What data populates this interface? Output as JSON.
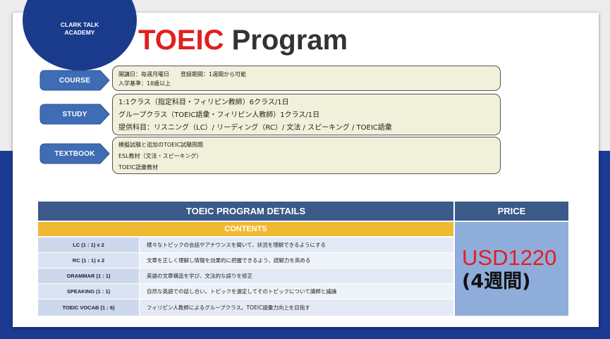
{
  "logo": {
    "line1": "CLARK TALK",
    "line2": "ACADEMY"
  },
  "title": {
    "highlight": "TOEIC",
    "rest": " Program"
  },
  "sections": [
    {
      "tag": "COURSE",
      "lines": [
        "開講日：毎週月曜日　　登録期間：1週間から可能",
        "入学基準：18歳以上"
      ]
    },
    {
      "tag": "STUDY",
      "lines": [
        "1:1クラス（指定科目・フィリピン教師）6クラス/1日",
        "グループクラス（TOEIC語彙・フィリピン人教師）1クラス/1日",
        "提供科目：リスニング（LC）/ リーディング（RC）/ 文法 / スピーキング / TOEIC語彙"
      ]
    },
    {
      "tag": "TEXTBOOK",
      "lines": [
        "模擬試験と追加のTOEIC試験問題",
        "ESL教材（文法・スピーキング）",
        "TOEIC語彙教材"
      ]
    }
  ],
  "table": {
    "header_details": "TOEIC PROGRAM DETAILS",
    "header_price": "PRICE",
    "contents_label": "CONTENTS",
    "rows": [
      {
        "label": "LC (1 : 1) x 2",
        "desc": "様々なトピックの会話やアナウンスを聞いて、状況を理解できるようにする"
      },
      {
        "label": "RC (1 : 1) x 2",
        "desc": "文章を正しく理解し情報を効果的に把握できるよう、読解力を高める"
      },
      {
        "label": "GRAMMAR (1 : 1)",
        "desc": "英語の文章構造を学び、文法的な誤りを修正"
      },
      {
        "label": "SPEAKING (1 : 1)",
        "desc": "自然な英語での話し合い。トピックを選定してそのトピックについて講師と議論"
      },
      {
        "label": "TOEIC VOCAB (1 : 6)",
        "desc": "フィリピン人教師によるグループクラス。TOEIC語彙力向上を目指す"
      }
    ],
    "price_amount": "USD1220",
    "price_duration": "(4週間)"
  },
  "colors": {
    "accent_red": "#e02020",
    "navy": "#1a3a8c",
    "tag_blue": "#3f6db5",
    "header_blue": "#3b5a8a",
    "gold": "#f1b931",
    "price_bg": "#8faddb"
  }
}
